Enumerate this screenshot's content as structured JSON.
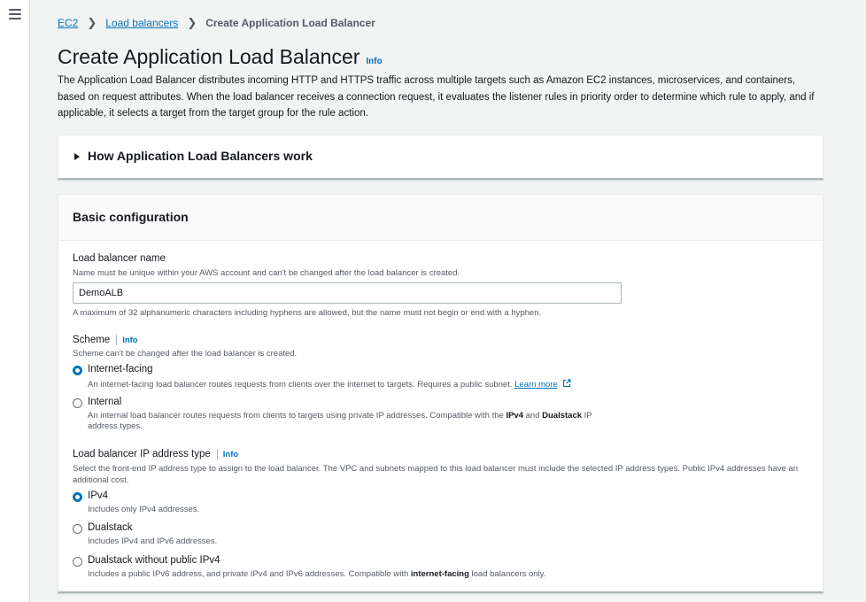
{
  "breadcrumb": {
    "items": [
      "EC2",
      "Load balancers"
    ],
    "current": "Create Application Load Balancer"
  },
  "page": {
    "title": "Create Application Load Balancer",
    "info": "Info",
    "description": "The Application Load Balancer distributes incoming HTTP and HTTPS traffic across multiple targets such as Amazon EC2 instances, microservices, and containers, based on request attributes. When the load balancer receives a connection request, it evaluates the listener rules in priority order to determine which rule to apply, and if applicable, it selects a target from the target group for the rule action."
  },
  "how_panel": {
    "title": "How Application Load Balancers work"
  },
  "basic": {
    "title": "Basic configuration",
    "name": {
      "label": "Load balancer name",
      "description": "Name must be unique within your AWS account and can't be changed after the load balancer is created.",
      "value": "DemoALB",
      "constraint": "A maximum of 32 alphanumeric characters including hyphens are allowed, but the name must not begin or end with a hyphen."
    },
    "scheme": {
      "label": "Scheme",
      "info": "Info",
      "description": "Scheme can't be changed after the load balancer is created.",
      "options": [
        {
          "label": "Internet-facing",
          "description": "An internet-facing load balancer routes requests from clients over the internet to targets. Requires a public subnet.",
          "learn_more": "Learn more",
          "selected": true
        },
        {
          "label": "Internal",
          "desc_before": "An internal load balancer routes requests from clients to targets using private IP addresses. Compatible with the ",
          "desc_b1": "IPv4",
          "desc_mid": " and ",
          "desc_b2": "Dualstack",
          "desc_after": " IP address types.",
          "selected": false
        }
      ]
    },
    "ip_type": {
      "label": "Load balancer IP address type",
      "info": "Info",
      "description": "Select the front-end IP address type to assign to the load balancer. The VPC and subnets mapped to this load balancer must include the selected IP address types. Public IPv4 addresses have an additional cost.",
      "options": [
        {
          "label": "IPv4",
          "description": "Includes only IPv4 addresses.",
          "selected": true
        },
        {
          "label": "Dualstack",
          "description": "Includes IPv4 and IPv6 addresses.",
          "selected": false
        },
        {
          "label": "Dualstack without public IPv4",
          "desc_before": "Includes a public IPv6 address, and private IPv4 and IPv6 addresses. Compatible with ",
          "desc_b": "internet-facing",
          "desc_after": " load balancers only.",
          "selected": false
        }
      ]
    }
  },
  "icons": {
    "menu": "hamburger-menu-icon",
    "caret": "caret-right-icon",
    "external": "external-link-icon"
  },
  "colors": {
    "link": "#0073bb",
    "background": "#f2f3f3",
    "text": "#16191f",
    "muted": "#545b64"
  }
}
